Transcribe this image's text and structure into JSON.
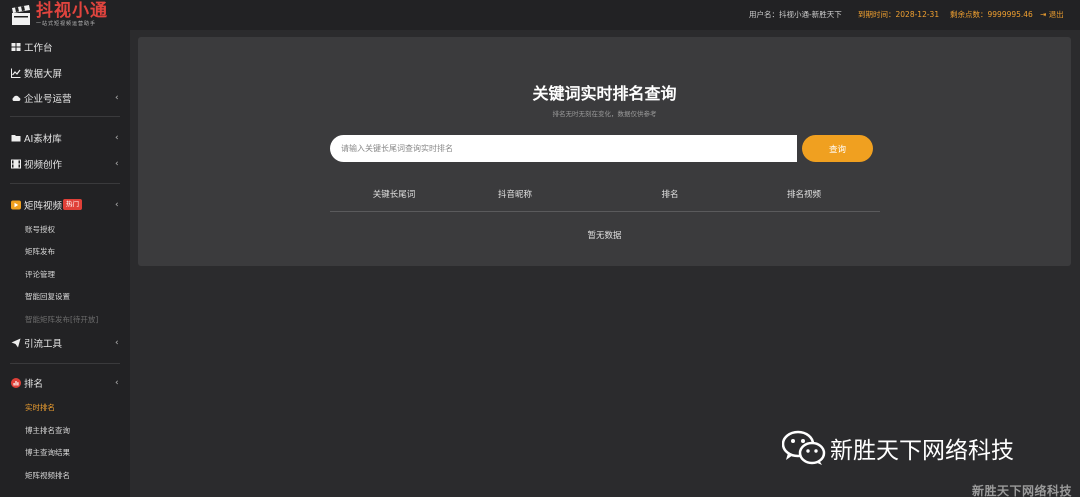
{
  "header": {
    "logo_title": "抖视小通",
    "logo_subtitle": "一站式短视频运营助手",
    "user_label": "用户名：抖视小通-新胜天下",
    "expire_label": "到期时间：2028-12-31",
    "points_label": "剩余点数：9999995.46",
    "logout_label": "退出",
    "accent_color": "#f0a030",
    "brand_color": "#e0443e"
  },
  "sidebar": {
    "items": [
      {
        "label": "工作台",
        "icon": "window-icon"
      },
      {
        "label": "数据大屏",
        "icon": "line-chart-icon"
      },
      {
        "label": "企业号运营",
        "icon": "cloud-icon"
      },
      {
        "label": "AI素材库",
        "icon": "folder-icon"
      },
      {
        "label": "视频创作",
        "icon": "film-icon"
      },
      {
        "label": "矩阵视频",
        "icon": "matrix-video-icon",
        "badge": "热门"
      },
      {
        "label": "引流工具",
        "icon": "paper-plane-icon"
      },
      {
        "label": "排名",
        "icon": "ranking-icon"
      }
    ],
    "matrix_sub": [
      "账号授权",
      "矩阵发布",
      "评论管理",
      "智能回复设置",
      "智能矩阵发布[待开放]"
    ],
    "ranking_sub": [
      "实时排名",
      "博主排名查询",
      "博主查询结果",
      "矩阵视频排名"
    ]
  },
  "main": {
    "title": "关键词实时排名查询",
    "subtitle": "排名无时无刻在变化，数据仅供参考",
    "search_placeholder": "请输入关键长尾词查询实时排名",
    "search_value": "",
    "search_button": "查询",
    "columns": [
      "关键长尾词",
      "抖音昵称",
      "排名",
      "排名视频"
    ],
    "empty_text": "暂无数据"
  },
  "watermark": {
    "text": "新胜天下网络科技",
    "bottom_text": "新胜天下网络科技"
  }
}
